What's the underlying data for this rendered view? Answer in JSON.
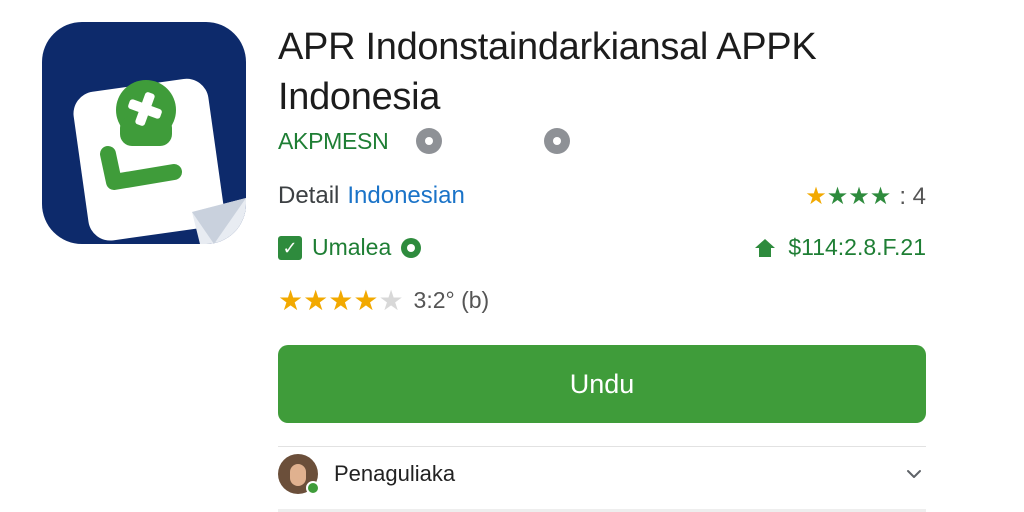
{
  "app": {
    "title_line1": "APR Indonstaindarkiansal APPK",
    "title_line2": "Indonesia",
    "developer": "AKPMESN",
    "icon_name": "app-logo-icon"
  },
  "detail": {
    "label": "Detail",
    "language": "Indonesian"
  },
  "top_rating": {
    "stars_filled": 4,
    "value": ": 4"
  },
  "status": {
    "label": "Umalea"
  },
  "price": {
    "text": "$114:2.8.F.21"
  },
  "rating": {
    "stars_filled": 4,
    "stars_total": 5,
    "score_text": "3:2° (b)"
  },
  "download_button": {
    "label": "Undu"
  },
  "reviewer": {
    "name": "Penaguliaka"
  },
  "colors": {
    "brand_green": "#3f9c3a",
    "icon_background": "#0d2a6b",
    "link_blue": "#1a73c8",
    "star_gold": "#f2a900"
  }
}
